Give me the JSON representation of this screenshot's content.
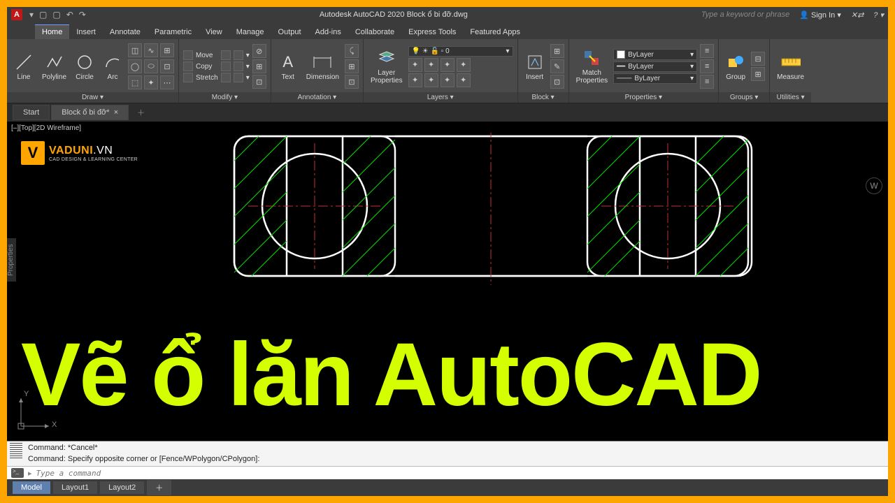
{
  "title": "Autodesk AutoCAD 2020   Block ổ bi đỡ.dwg",
  "search_placeholder": "Type a keyword or phrase",
  "signin": "Sign In",
  "tabs": [
    "Home",
    "Insert",
    "Annotate",
    "Parametric",
    "View",
    "Manage",
    "Output",
    "Add-ins",
    "Collaborate",
    "Express Tools",
    "Featured Apps"
  ],
  "active_tab": "Home",
  "panels": {
    "draw": {
      "title": "Draw ▾",
      "line": "Line",
      "polyline": "Polyline",
      "circle": "Circle",
      "arc": "Arc"
    },
    "modify": {
      "title": "Modify ▾",
      "move": "Move",
      "copy": "Copy",
      "stretch": "Stretch"
    },
    "annotation": {
      "title": "Annotation ▾",
      "text": "Text",
      "dimension": "Dimension"
    },
    "layers": {
      "title": "Layers ▾",
      "lp": "Layer\nProperties"
    },
    "block": {
      "title": "Block ▾",
      "insert": "Insert"
    },
    "properties": {
      "title": "Properties ▾",
      "match": "Match\nProperties",
      "bylayer": "ByLayer"
    },
    "groups": {
      "title": "Groups ▾",
      "group": "Group"
    },
    "utilities": {
      "title": "Utilities ▾",
      "measure": "Measure"
    }
  },
  "file_tabs": {
    "start": "Start",
    "current": "Block ổ bi đỡ*"
  },
  "viewlabel": "[–][Top][2D Wireframe]",
  "brand": {
    "name": "VADUNI",
    "suffix": ".VN",
    "sub": "CAD DESIGN & LEARNING CENTER"
  },
  "overlay": "Vẽ ổ lăn AutoCAD",
  "ucs": {
    "x": "X",
    "y": "Y"
  },
  "sidepanel": "Properties",
  "cmd": {
    "l1": "Command: *Cancel*",
    "l2": "Command: Specify opposite corner or [Fence/WPolygon/CPolygon]:",
    "placeholder": "Type a command"
  },
  "status": {
    "model": "Model",
    "l1": "Layout1",
    "l2": "Layout2"
  },
  "viewcube": "W"
}
